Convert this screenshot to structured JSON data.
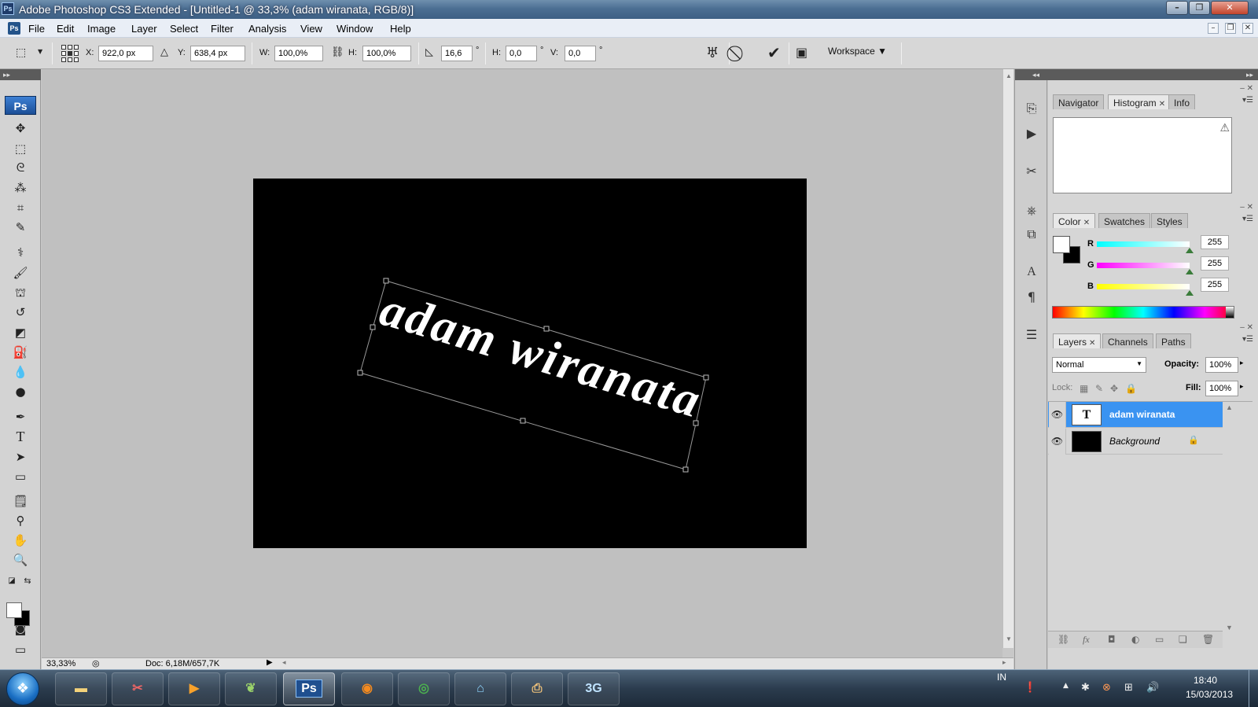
{
  "window": {
    "app_badge": "Ps",
    "title": "Adobe Photoshop CS3 Extended - [Untitled-1 @ 33,3% (adam wiranata, RGB/8)]",
    "minimize_icon": "minimize-icon",
    "maximize_icon": "restore-icon",
    "close_icon": "close-icon"
  },
  "menu": {
    "items": [
      "File",
      "Edit",
      "Image",
      "Layer",
      "Select",
      "Filter",
      "Analysis",
      "View",
      "Window",
      "Help"
    ]
  },
  "options": {
    "x_label": "X:",
    "x_value": "922,0 px",
    "y_label": "Y:",
    "y_value": "638,4 px",
    "w_label": "W:",
    "w_value": "100,0%",
    "h_label": "H:",
    "h_value": "100,0%",
    "angle_value": "16,6",
    "angle_unit": "°",
    "skew_h_label": "H:",
    "skew_h_value": "0,0",
    "skew_h_unit": "°",
    "skew_v_label": "V:",
    "skew_v_value": "0,0",
    "skew_v_unit": "°",
    "workspace_label": "Workspace ▼"
  },
  "tools": {
    "logo": "Ps",
    "icons": [
      "move-tool-icon",
      "marquee-tool-icon",
      "lasso-tool-icon",
      "magic-wand-tool-icon",
      "crop-tool-icon",
      "slice-tool-icon",
      "healing-brush-icon",
      "brush-tool-icon",
      "clone-stamp-icon",
      "history-brush-icon",
      "eraser-tool-icon",
      "paint-bucket-icon",
      "blur-tool-icon",
      "dodge-tool-icon",
      "pen-tool-icon",
      "type-tool-icon",
      "path-selection-icon",
      "rectangle-tool-icon",
      "notes-tool-icon",
      "eyedropper-tool-icon",
      "hand-tool-icon",
      "zoom-tool-icon"
    ]
  },
  "canvas": {
    "text": "adam wiranata",
    "background": "#000000",
    "text_color": "#ffffff",
    "rotation_deg": 16.6
  },
  "status": {
    "zoom": "33,33%",
    "doc": "Doc: 6,18M/657,7K"
  },
  "panels": {
    "group1_tabs": [
      "Navigator",
      "Histogram",
      "Info"
    ],
    "group1_active": "Histogram",
    "group2_tabs": [
      "Color",
      "Swatches",
      "Styles"
    ],
    "group2_active": "Color",
    "color": {
      "r_label": "R",
      "r_value": "255",
      "g_label": "G",
      "g_value": "255",
      "b_label": "B",
      "b_value": "255"
    },
    "group3_tabs": [
      "Layers",
      "Channels",
      "Paths"
    ],
    "group3_active": "Layers",
    "layers": {
      "blend_mode": "Normal",
      "opacity_label": "Opacity:",
      "opacity_value": "100%",
      "lock_label": "Lock:",
      "fill_label": "Fill:",
      "fill_value": "100%",
      "items": [
        {
          "name": "adam wiranata",
          "thumb": "T",
          "selected": true
        },
        {
          "name": "Background",
          "thumb": "",
          "selected": false
        }
      ]
    }
  },
  "taskbar": {
    "apps": [
      "windows-explorer",
      "snipping-tool",
      "media-player",
      "green-app",
      "photoshop",
      "firefox",
      "chrome",
      "hp-app",
      "printer-app",
      "3g-modem"
    ],
    "ps_label": "Ps",
    "threeg_label": "3G",
    "language": "IN",
    "time": "18:40",
    "date": "15/03/2013"
  }
}
